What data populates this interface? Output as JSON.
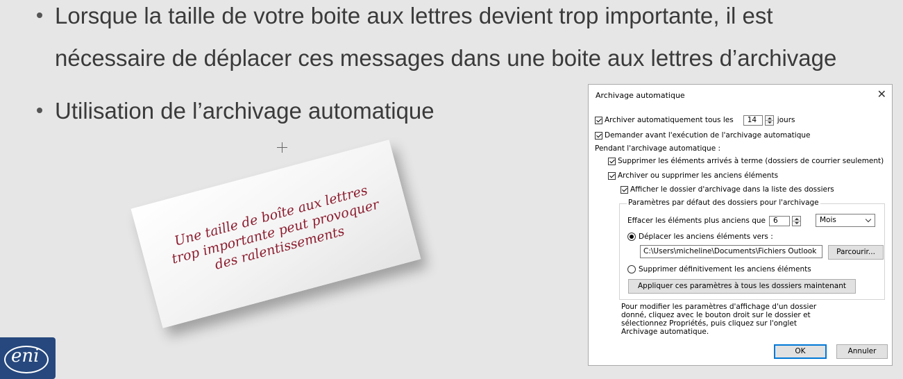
{
  "slide": {
    "bullets": [
      {
        "line1": "Lorsque la taille de votre boite aux lettres devient trop importante, il est",
        "line2": "nécessaire de déplacer ces messages dans une boite aux lettres d’archivage"
      },
      {
        "line1": "Utilisation de l’archivage automatique"
      }
    ],
    "note": {
      "line1": "Une taille de boîte aux lettres",
      "line2": "trop importante peut provoquer",
      "line3": "des ralentissements"
    },
    "logo_text": "eni"
  },
  "dialog": {
    "title": "Archivage automatique",
    "close_glyph": "✕",
    "auto_archive": {
      "label_before": "Archiver automatiquement tous les",
      "value": "14",
      "label_after": "jours",
      "checked": true
    },
    "ask_before": {
      "label": "Demander avant l'exécution de l'archivage automatique",
      "checked": true
    },
    "during_label": "Pendant l'archivage automatique :",
    "delete_expired": {
      "label": "Supprimer les éléments arrivés à terme (dossiers de courrier seulement)",
      "checked": true
    },
    "archive_old": {
      "label": "Archiver ou supprimer les anciens éléments",
      "checked": true
    },
    "show_folder": {
      "label": "Afficher le dossier d'archivage dans la liste des dossiers",
      "checked": true
    },
    "group_label": "Paramètres par défaut des dossiers pour l'archivage",
    "clean_older": {
      "label": "Effacer les éléments plus anciens que",
      "value": "6",
      "unit": "Mois"
    },
    "move_old": {
      "label": "Déplacer les anciens éléments vers :",
      "selected": true
    },
    "path": "C:\\Users\\micheline\\Documents\\Fichiers Outlook",
    "browse_label": "Parcourir...",
    "delete_perm": {
      "label": "Supprimer définitivement les anciens éléments",
      "selected": false
    },
    "apply_all_label": "Appliquer ces paramètres à tous les dossiers maintenant",
    "info_lines": [
      "Pour modifier les paramètres d'affichage d'un dossier",
      "donné, cliquez avec le bouton droit sur le dossier et",
      "sélectionnez Propriétés, puis cliquez sur l'onglet",
      "Archivage automatique."
    ],
    "ok_label": "OK",
    "cancel_label": "Annuler"
  }
}
